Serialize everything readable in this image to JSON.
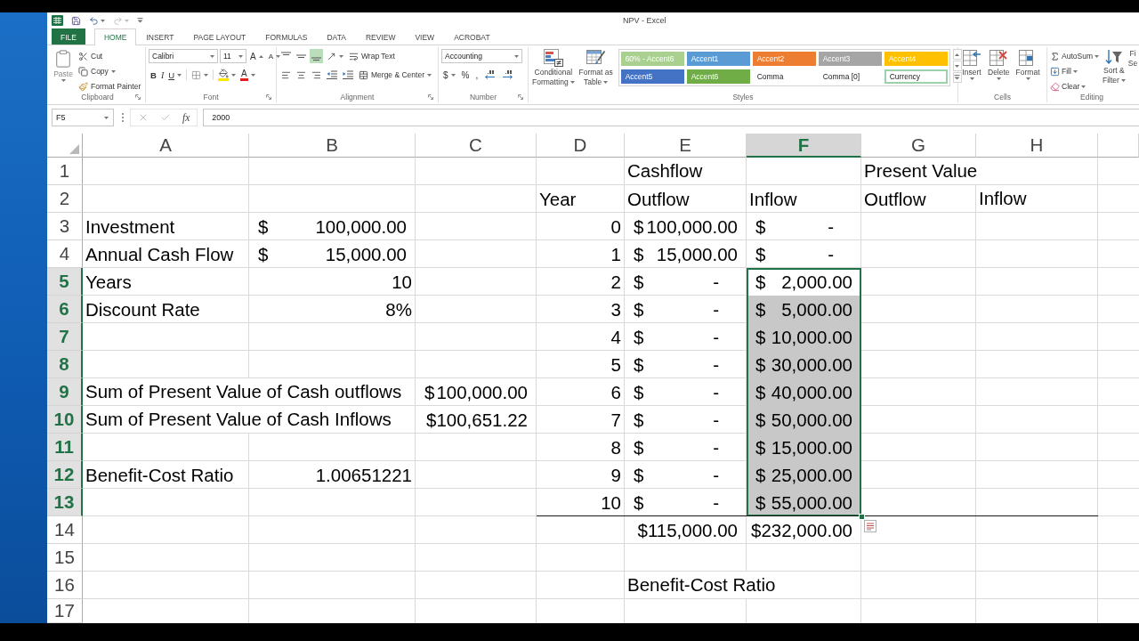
{
  "window": {
    "title": "NPV - Excel"
  },
  "ribbon_tabs": [
    {
      "label": "FILE",
      "kind": "file",
      "selected": false
    },
    {
      "label": "HOME",
      "kind": "tab",
      "selected": true
    },
    {
      "label": "INSERT",
      "kind": "tab",
      "selected": false
    },
    {
      "label": "PAGE LAYOUT",
      "kind": "tab",
      "selected": false
    },
    {
      "label": "FORMULAS",
      "kind": "tab",
      "selected": false
    },
    {
      "label": "DATA",
      "kind": "tab",
      "selected": false
    },
    {
      "label": "REVIEW",
      "kind": "tab",
      "selected": false
    },
    {
      "label": "VIEW",
      "kind": "tab",
      "selected": false
    },
    {
      "label": "ACROBAT",
      "kind": "tab",
      "selected": false
    }
  ],
  "ribbon": {
    "clipboard": {
      "label": "Clipboard",
      "paste": "Paste",
      "cut": "Cut",
      "copy": "Copy",
      "format_painter": "Format Painter"
    },
    "font": {
      "label": "Font",
      "font_name": "Calibri",
      "font_size": "11",
      "grow": "A",
      "shrink": "A",
      "styles": [
        {
          "kind": "bold",
          "label": "B"
        },
        {
          "kind": "italic",
          "label": "I"
        },
        {
          "kind": "underline",
          "label": "U"
        }
      ],
      "font_color": "A"
    },
    "alignment": {
      "label": "Alignment",
      "vertical": [
        {
          "kind": "top",
          "selected": false
        },
        {
          "kind": "middle",
          "selected": false
        },
        {
          "kind": "bottom",
          "selected": true
        }
      ],
      "wrap_text": "Wrap Text",
      "merge": "Merge & Center"
    },
    "number": {
      "label": "Number",
      "format": "Accounting",
      "symbols": [
        {
          "kind": "currency",
          "label": "$"
        },
        {
          "kind": "percent",
          "label": "%"
        },
        {
          "kind": "comma",
          "label": ","
        }
      ]
    },
    "styles": {
      "label": "Styles",
      "conditional_formatting": [
        "Conditional",
        "Formatting"
      ],
      "format_as_table": [
        "Format as",
        "Table"
      ],
      "gallery": [
        {
          "label": "60% - Accent6",
          "color": "#a9d08e",
          "selected": false
        },
        {
          "label": "Accent1",
          "color": "#5b9bd5",
          "selected": false
        },
        {
          "label": "Accent2",
          "color": "#ed7d31",
          "selected": false
        },
        {
          "label": "Accent3",
          "color": "#a5a5a5",
          "selected": false
        },
        {
          "label": "Accent4",
          "color": "#ffc000",
          "selected": false
        },
        {
          "label": "Accent5",
          "color": "#4472c4",
          "selected": false
        },
        {
          "label": "Accent6",
          "color": "#70ad47",
          "selected": false
        },
        {
          "label": "Comma",
          "selected": false
        },
        {
          "label": "Comma [0]",
          "selected": false
        },
        {
          "label": "Currency",
          "selected": true
        }
      ]
    },
    "cells": {
      "label": "Cells",
      "buttons": [
        {
          "kind": "insert",
          "label": "Insert"
        },
        {
          "kind": "delete",
          "label": "Delete"
        },
        {
          "kind": "format",
          "label": "Format"
        }
      ]
    },
    "editing": {
      "label": "Editing",
      "autosum": "AutoSum",
      "fill": "Fill",
      "clear": "Clear",
      "sort_filter": [
        "Sort &",
        "Filter"
      ],
      "find_select": [
        "Fi",
        "Se"
      ]
    }
  },
  "formula_bar": {
    "name_box": "F5",
    "function_label": "fx",
    "value": "2000"
  },
  "sheet": {
    "columns": [
      {
        "label": "A",
        "selected": false
      },
      {
        "label": "B",
        "selected": false
      },
      {
        "label": "C",
        "selected": false
      },
      {
        "label": "D",
        "selected": false
      },
      {
        "label": "E",
        "selected": false
      },
      {
        "label": "F",
        "selected": true
      },
      {
        "label": "G",
        "selected": false
      },
      {
        "label": "H",
        "selected": false
      }
    ],
    "rows": [
      {
        "number": "1",
        "selected": false,
        "cells": [
          {
            "kind": "empty"
          },
          {
            "kind": "empty"
          },
          {
            "kind": "empty"
          },
          {
            "kind": "empty"
          },
          {
            "kind": "text",
            "text": "Cashflow"
          },
          {
            "kind": "empty"
          },
          {
            "kind": "text",
            "text": "Present Value"
          }
        ]
      },
      {
        "number": "2",
        "selected": false,
        "cells": [
          {
            "kind": "empty"
          },
          {
            "kind": "empty"
          },
          {
            "kind": "empty"
          },
          {
            "kind": "text",
            "text": "Year"
          },
          {
            "kind": "text",
            "text": "Outflow"
          },
          {
            "kind": "text",
            "text": "Inflow"
          },
          {
            "kind": "text",
            "text": "Outflow"
          },
          {
            "kind": "text",
            "text": "Inflow"
          }
        ]
      },
      {
        "number": "3",
        "selected": false,
        "cells": [
          {
            "kind": "text",
            "text": "Investment"
          },
          {
            "kind": "accounting",
            "symbol": "$",
            "amount": "100,000.00"
          },
          {
            "kind": "empty"
          },
          {
            "kind": "number",
            "text": "0"
          },
          {
            "kind": "accounting",
            "symbol": "$",
            "amount": "100,000.00"
          },
          {
            "kind": "accounting_zero",
            "symbol": "$",
            "amount": "-"
          }
        ]
      },
      {
        "number": "4",
        "selected": false,
        "cells": [
          {
            "kind": "text",
            "text": "Annual Cash Flow"
          },
          {
            "kind": "accounting",
            "symbol": "$",
            "amount": "15,000.00"
          },
          {
            "kind": "empty"
          },
          {
            "kind": "number",
            "text": "1"
          },
          {
            "kind": "accounting",
            "symbol": "$",
            "amount": "15,000.00"
          },
          {
            "kind": "accounting_zero",
            "symbol": "$",
            "amount": "-"
          }
        ]
      },
      {
        "number": "5",
        "selected": true,
        "cells": [
          {
            "kind": "text",
            "text": "Years"
          },
          {
            "kind": "number",
            "text": "10"
          },
          {
            "kind": "empty"
          },
          {
            "kind": "number",
            "text": "2"
          },
          {
            "kind": "accounting_zero",
            "symbol": "$",
            "amount": "-"
          },
          {
            "kind": "accounting",
            "symbol": "$",
            "amount": "2,000.00"
          }
        ]
      },
      {
        "number": "6",
        "selected": true,
        "cells": [
          {
            "kind": "text",
            "text": "Discount Rate"
          },
          {
            "kind": "number",
            "text": "8%"
          },
          {
            "kind": "empty"
          },
          {
            "kind": "number",
            "text": "3"
          },
          {
            "kind": "accounting_zero",
            "symbol": "$",
            "amount": "-"
          },
          {
            "kind": "accounting",
            "symbol": "$",
            "amount": "5,000.00"
          }
        ]
      },
      {
        "number": "7",
        "selected": true,
        "cells": [
          {
            "kind": "empty"
          },
          {
            "kind": "empty"
          },
          {
            "kind": "empty"
          },
          {
            "kind": "number",
            "text": "4"
          },
          {
            "kind": "accounting_zero",
            "symbol": "$",
            "amount": "-"
          },
          {
            "kind": "accounting",
            "symbol": "$",
            "amount": "10,000.00"
          }
        ]
      },
      {
        "number": "8",
        "selected": true,
        "cells": [
          {
            "kind": "empty"
          },
          {
            "kind": "empty"
          },
          {
            "kind": "empty"
          },
          {
            "kind": "number",
            "text": "5"
          },
          {
            "kind": "accounting_zero",
            "symbol": "$",
            "amount": "-"
          },
          {
            "kind": "accounting",
            "symbol": "$",
            "amount": "30,000.00"
          }
        ]
      },
      {
        "number": "9",
        "selected": true,
        "cells": [
          {
            "kind": "text",
            "text": "Sum of Present Value of Cash outflows"
          },
          {
            "kind": "empty"
          },
          {
            "kind": "accounting",
            "symbol": "$",
            "amount": "100,000.00"
          },
          {
            "kind": "number",
            "text": "6"
          },
          {
            "kind": "accounting_zero",
            "symbol": "$",
            "amount": "-"
          },
          {
            "kind": "accounting",
            "symbol": "$",
            "amount": "40,000.00"
          }
        ]
      },
      {
        "number": "10",
        "selected": true,
        "cells": [
          {
            "kind": "text",
            "text": "Sum of Present Value of Cash Inflows"
          },
          {
            "kind": "empty"
          },
          {
            "kind": "currency",
            "text": "$100,651.22"
          },
          {
            "kind": "number",
            "text": "7"
          },
          {
            "kind": "accounting_zero",
            "symbol": "$",
            "amount": "-"
          },
          {
            "kind": "accounting",
            "symbol": "$",
            "amount": "50,000.00"
          }
        ]
      },
      {
        "number": "11",
        "selected": true,
        "cells": [
          {
            "kind": "empty"
          },
          {
            "kind": "empty"
          },
          {
            "kind": "empty"
          },
          {
            "kind": "number",
            "text": "8"
          },
          {
            "kind": "accounting_zero",
            "symbol": "$",
            "amount": "-"
          },
          {
            "kind": "accounting",
            "symbol": "$",
            "amount": "15,000.00"
          }
        ]
      },
      {
        "number": "12",
        "selected": true,
        "cells": [
          {
            "kind": "text",
            "text": "Benefit-Cost Ratio"
          },
          {
            "kind": "number",
            "text": "1.00651221"
          },
          {
            "kind": "empty"
          },
          {
            "kind": "number",
            "text": "9"
          },
          {
            "kind": "accounting_zero",
            "symbol": "$",
            "amount": "-"
          },
          {
            "kind": "accounting",
            "symbol": "$",
            "amount": "25,000.00"
          }
        ]
      },
      {
        "number": "13",
        "selected": true,
        "cells": [
          {
            "kind": "empty"
          },
          {
            "kind": "empty"
          },
          {
            "kind": "empty"
          },
          {
            "kind": "number",
            "text": "10",
            "border_bottom": true
          },
          {
            "kind": "accounting_zero",
            "symbol": "$",
            "amount": "-",
            "border_bottom": true
          },
          {
            "kind": "accounting",
            "symbol": "$",
            "amount": "55,000.00",
            "border_bottom": true
          },
          {
            "kind": "empty",
            "border_bottom": true
          },
          {
            "kind": "empty",
            "border_bottom": true
          }
        ]
      },
      {
        "number": "14",
        "selected": false,
        "cells": [
          {
            "kind": "empty"
          },
          {
            "kind": "empty"
          },
          {
            "kind": "empty"
          },
          {
            "kind": "empty"
          },
          {
            "kind": "currency",
            "text": "$115,000.00"
          },
          {
            "kind": "currency",
            "text": "$232,000.00"
          }
        ]
      },
      {
        "number": "15",
        "selected": false
      },
      {
        "number": "16",
        "selected": false,
        "cells": [
          {
            "kind": "empty"
          },
          {
            "kind": "empty"
          },
          {
            "kind": "empty"
          },
          {
            "kind": "empty"
          },
          {
            "kind": "text",
            "text": "Benefit-Cost Ratio"
          }
        ]
      },
      {
        "number": "17",
        "selected": false
      }
    ]
  }
}
